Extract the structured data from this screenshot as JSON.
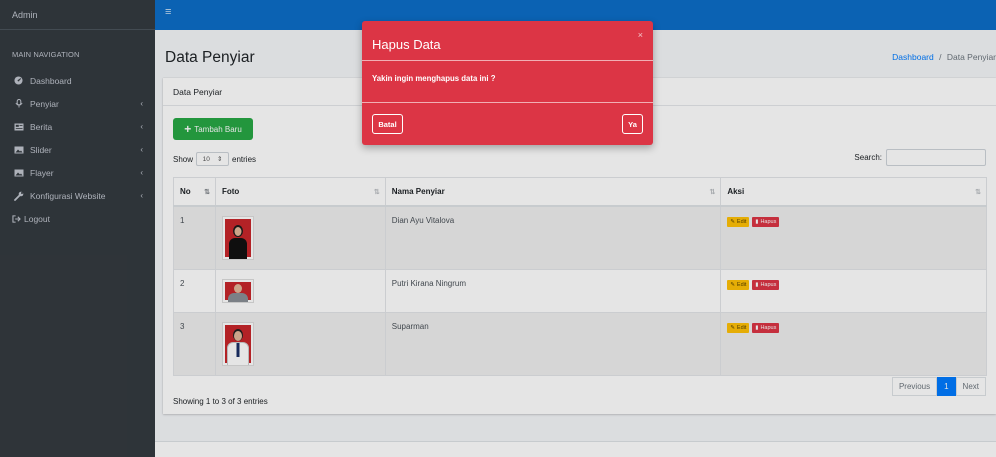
{
  "sidebar": {
    "brand": "Admin",
    "header": "MAIN NAVIGATION",
    "items": [
      {
        "label": "Dashboard",
        "icon": "tachometer-icon",
        "chevron": ""
      },
      {
        "label": "Penyiar",
        "icon": "microphone-icon",
        "chevron": "‹"
      },
      {
        "label": "Berita",
        "icon": "newspaper-icon",
        "chevron": "‹"
      },
      {
        "label": "Slider",
        "icon": "image-icon",
        "chevron": "‹"
      },
      {
        "label": "Flayer",
        "icon": "image-icon",
        "chevron": "‹"
      },
      {
        "label": "Konfigurasi Website",
        "icon": "wrench-icon",
        "chevron": "‹"
      }
    ],
    "logout": "Logout"
  },
  "topbar": {
    "menu_icon": "≡"
  },
  "header": {
    "title": "Data Penyiar",
    "breadcrumb_home": "Dashboard",
    "breadcrumb_sep": "/",
    "breadcrumb_current": "Data Penyiar"
  },
  "card": {
    "title": "Data Penyiar",
    "add_button": "Tambah Baru",
    "show_label": "Show",
    "entries_value": "10",
    "entries_label": "entries",
    "search_label": "Search:"
  },
  "table": {
    "columns": [
      "No",
      "Foto",
      "Nama Penyiar",
      "Aksi"
    ],
    "rows": [
      {
        "no": "1",
        "name": "Dian Ayu Vitalova"
      },
      {
        "no": "2",
        "name": "Putri Kirana Ningrum"
      },
      {
        "no": "3",
        "name": "Suparman"
      }
    ],
    "edit_label": "Edit",
    "delete_label": "Hapus"
  },
  "pagination": {
    "info": "Showing 1 to 3 of 3 entries",
    "previous": "Previous",
    "current": "1",
    "next": "Next"
  },
  "modal": {
    "title": "Hapus Data",
    "close": "×",
    "message": "Yakin ingin menghapus data ini ?",
    "cancel": "Batal",
    "confirm": "Ya"
  },
  "colors": {
    "sidebar": "#343a40",
    "topbar": "#0d6ec8",
    "modal": "#dc3545",
    "success": "#28a745",
    "warning": "#ffc107"
  }
}
